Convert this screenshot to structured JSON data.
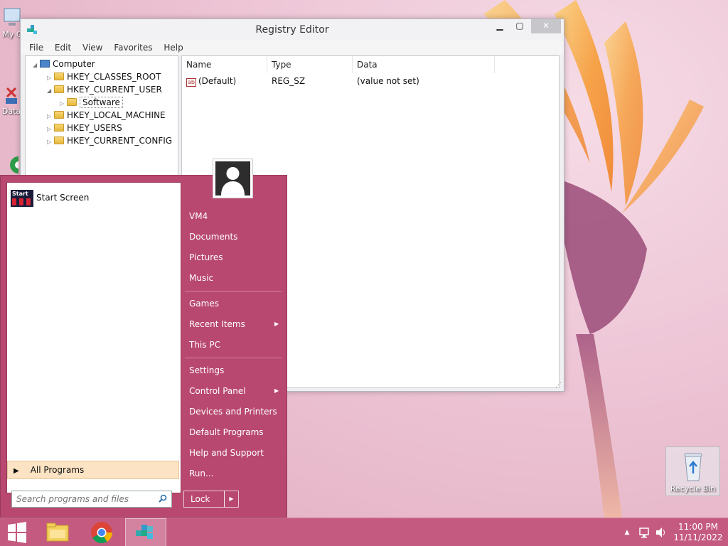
{
  "desktop": {
    "icons": [
      {
        "label": "My C"
      },
      {
        "label": "Data"
      }
    ],
    "recycle_bin_label": "Recycle Bin"
  },
  "registry_editor": {
    "title": "Registry Editor",
    "menu": [
      "File",
      "Edit",
      "View",
      "Favorites",
      "Help"
    ],
    "tree": {
      "root": "Computer",
      "hives": [
        "HKEY_CLASSES_ROOT",
        "HKEY_CURRENT_USER",
        "HKEY_LOCAL_MACHINE",
        "HKEY_USERS",
        "HKEY_CURRENT_CONFIG"
      ],
      "expanded_child": "Software"
    },
    "columns": [
      "Name",
      "Type",
      "Data"
    ],
    "rows": [
      {
        "name": "(Default)",
        "type": "REG_SZ",
        "data": "(value not set)"
      }
    ]
  },
  "start_menu": {
    "pinned": [
      {
        "label": "Start Screen",
        "icon_text": "Start"
      }
    ],
    "all_programs": "All Programs",
    "search_placeholder": "Search programs and files",
    "right_items": {
      "user": "VM4",
      "documents": "Documents",
      "pictures": "Pictures",
      "music": "Music",
      "games": "Games",
      "recent_items": "Recent Items",
      "this_pc": "This PC",
      "settings": "Settings",
      "control_panel": "Control Panel",
      "devices_printers": "Devices and Printers",
      "default_programs": "Default Programs",
      "help_support": "Help and Support",
      "run": "Run..."
    },
    "lock_label": "Lock"
  },
  "taskbar": {
    "time": "11:00 PM",
    "date": "11/11/2022",
    "apps": [
      "windows-start-icon",
      "file-explorer-icon",
      "chrome-icon",
      "registry-editor-icon"
    ]
  },
  "colors": {
    "start_menu_bg": "#b8486f",
    "taskbar_bg": "#c55a80",
    "all_programs_highlight": "#fbe3c3"
  }
}
